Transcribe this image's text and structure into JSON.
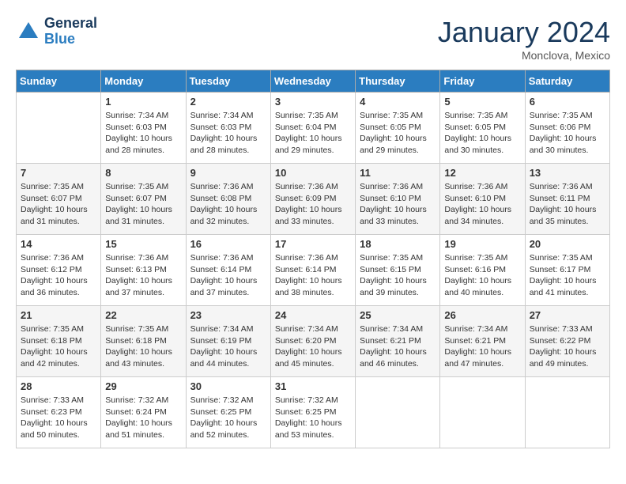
{
  "header": {
    "logo_line1": "General",
    "logo_line2": "Blue",
    "month": "January 2024",
    "location": "Monclova, Mexico"
  },
  "weekdays": [
    "Sunday",
    "Monday",
    "Tuesday",
    "Wednesday",
    "Thursday",
    "Friday",
    "Saturday"
  ],
  "weeks": [
    [
      {
        "day": "",
        "content": ""
      },
      {
        "day": "1",
        "content": "Sunrise: 7:34 AM\nSunset: 6:03 PM\nDaylight: 10 hours\nand 28 minutes."
      },
      {
        "day": "2",
        "content": "Sunrise: 7:34 AM\nSunset: 6:03 PM\nDaylight: 10 hours\nand 28 minutes."
      },
      {
        "day": "3",
        "content": "Sunrise: 7:35 AM\nSunset: 6:04 PM\nDaylight: 10 hours\nand 29 minutes."
      },
      {
        "day": "4",
        "content": "Sunrise: 7:35 AM\nSunset: 6:05 PM\nDaylight: 10 hours\nand 29 minutes."
      },
      {
        "day": "5",
        "content": "Sunrise: 7:35 AM\nSunset: 6:05 PM\nDaylight: 10 hours\nand 30 minutes."
      },
      {
        "day": "6",
        "content": "Sunrise: 7:35 AM\nSunset: 6:06 PM\nDaylight: 10 hours\nand 30 minutes."
      }
    ],
    [
      {
        "day": "7",
        "content": "Sunrise: 7:35 AM\nSunset: 6:07 PM\nDaylight: 10 hours\nand 31 minutes."
      },
      {
        "day": "8",
        "content": "Sunrise: 7:35 AM\nSunset: 6:07 PM\nDaylight: 10 hours\nand 31 minutes."
      },
      {
        "day": "9",
        "content": "Sunrise: 7:36 AM\nSunset: 6:08 PM\nDaylight: 10 hours\nand 32 minutes."
      },
      {
        "day": "10",
        "content": "Sunrise: 7:36 AM\nSunset: 6:09 PM\nDaylight: 10 hours\nand 33 minutes."
      },
      {
        "day": "11",
        "content": "Sunrise: 7:36 AM\nSunset: 6:10 PM\nDaylight: 10 hours\nand 33 minutes."
      },
      {
        "day": "12",
        "content": "Sunrise: 7:36 AM\nSunset: 6:10 PM\nDaylight: 10 hours\nand 34 minutes."
      },
      {
        "day": "13",
        "content": "Sunrise: 7:36 AM\nSunset: 6:11 PM\nDaylight: 10 hours\nand 35 minutes."
      }
    ],
    [
      {
        "day": "14",
        "content": "Sunrise: 7:36 AM\nSunset: 6:12 PM\nDaylight: 10 hours\nand 36 minutes."
      },
      {
        "day": "15",
        "content": "Sunrise: 7:36 AM\nSunset: 6:13 PM\nDaylight: 10 hours\nand 37 minutes."
      },
      {
        "day": "16",
        "content": "Sunrise: 7:36 AM\nSunset: 6:14 PM\nDaylight: 10 hours\nand 37 minutes."
      },
      {
        "day": "17",
        "content": "Sunrise: 7:36 AM\nSunset: 6:14 PM\nDaylight: 10 hours\nand 38 minutes."
      },
      {
        "day": "18",
        "content": "Sunrise: 7:35 AM\nSunset: 6:15 PM\nDaylight: 10 hours\nand 39 minutes."
      },
      {
        "day": "19",
        "content": "Sunrise: 7:35 AM\nSunset: 6:16 PM\nDaylight: 10 hours\nand 40 minutes."
      },
      {
        "day": "20",
        "content": "Sunrise: 7:35 AM\nSunset: 6:17 PM\nDaylight: 10 hours\nand 41 minutes."
      }
    ],
    [
      {
        "day": "21",
        "content": "Sunrise: 7:35 AM\nSunset: 6:18 PM\nDaylight: 10 hours\nand 42 minutes."
      },
      {
        "day": "22",
        "content": "Sunrise: 7:35 AM\nSunset: 6:18 PM\nDaylight: 10 hours\nand 43 minutes."
      },
      {
        "day": "23",
        "content": "Sunrise: 7:34 AM\nSunset: 6:19 PM\nDaylight: 10 hours\nand 44 minutes."
      },
      {
        "day": "24",
        "content": "Sunrise: 7:34 AM\nSunset: 6:20 PM\nDaylight: 10 hours\nand 45 minutes."
      },
      {
        "day": "25",
        "content": "Sunrise: 7:34 AM\nSunset: 6:21 PM\nDaylight: 10 hours\nand 46 minutes."
      },
      {
        "day": "26",
        "content": "Sunrise: 7:34 AM\nSunset: 6:21 PM\nDaylight: 10 hours\nand 47 minutes."
      },
      {
        "day": "27",
        "content": "Sunrise: 7:33 AM\nSunset: 6:22 PM\nDaylight: 10 hours\nand 49 minutes."
      }
    ],
    [
      {
        "day": "28",
        "content": "Sunrise: 7:33 AM\nSunset: 6:23 PM\nDaylight: 10 hours\nand 50 minutes."
      },
      {
        "day": "29",
        "content": "Sunrise: 7:32 AM\nSunset: 6:24 PM\nDaylight: 10 hours\nand 51 minutes."
      },
      {
        "day": "30",
        "content": "Sunrise: 7:32 AM\nSunset: 6:25 PM\nDaylight: 10 hours\nand 52 minutes."
      },
      {
        "day": "31",
        "content": "Sunrise: 7:32 AM\nSunset: 6:25 PM\nDaylight: 10 hours\nand 53 minutes."
      },
      {
        "day": "",
        "content": ""
      },
      {
        "day": "",
        "content": ""
      },
      {
        "day": "",
        "content": ""
      }
    ]
  ]
}
